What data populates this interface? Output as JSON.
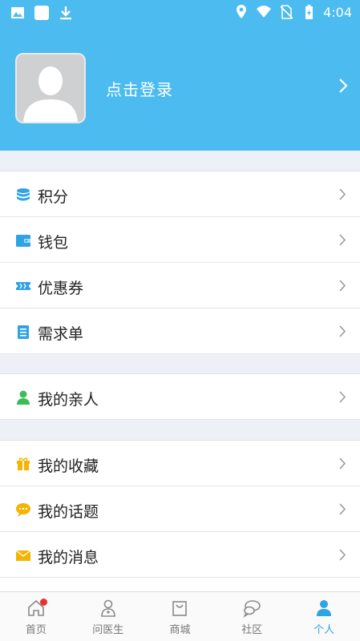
{
  "status": {
    "time": "4:04"
  },
  "header": {
    "login_text": "点击登录"
  },
  "menu": {
    "group1": [
      {
        "label": "积分",
        "icon": "coins-icon"
      },
      {
        "label": "钱包",
        "icon": "wallet-icon"
      },
      {
        "label": "优惠券",
        "icon": "coupon-icon"
      },
      {
        "label": "需求单",
        "icon": "clipboard-icon"
      }
    ],
    "group2": [
      {
        "label": "我的亲人",
        "icon": "person-icon"
      }
    ],
    "group3": [
      {
        "label": "我的收藏",
        "icon": "gift-icon"
      },
      {
        "label": "我的话题",
        "icon": "chat-bubble-icon"
      },
      {
        "label": "我的消息",
        "icon": "envelope-icon"
      }
    ]
  },
  "tabs": [
    {
      "label": "首页",
      "icon": "home-icon",
      "badge": true
    },
    {
      "label": "问医生",
      "icon": "doctor-icon"
    },
    {
      "label": "商城",
      "icon": "shopping-bag-icon"
    },
    {
      "label": "社区",
      "icon": "community-icon"
    },
    {
      "label": "个人",
      "icon": "profile-icon",
      "active": true
    }
  ],
  "colors": {
    "accent": "#4bbbf0",
    "active_tab": "#2fa3e6",
    "badge": "#e8322d"
  }
}
